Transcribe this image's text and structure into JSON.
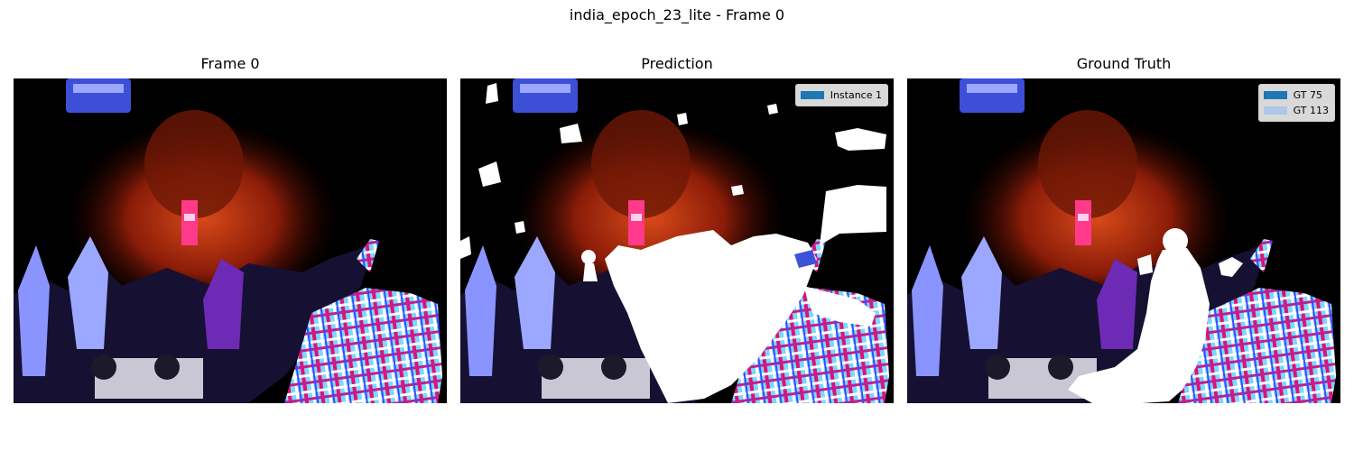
{
  "figure": {
    "title": "india_epoch_23_lite - Frame 0"
  },
  "panels": [
    {
      "title": "Frame 0"
    },
    {
      "title": "Prediction",
      "legend": [
        {
          "label": "Instance 1",
          "color": "#1f77b4"
        }
      ]
    },
    {
      "title": "Ground Truth",
      "legend": [
        {
          "label": "GT 75",
          "color": "#1f77b4"
        },
        {
          "label": "GT 113",
          "color": "#aec7e8"
        }
      ]
    }
  ]
}
